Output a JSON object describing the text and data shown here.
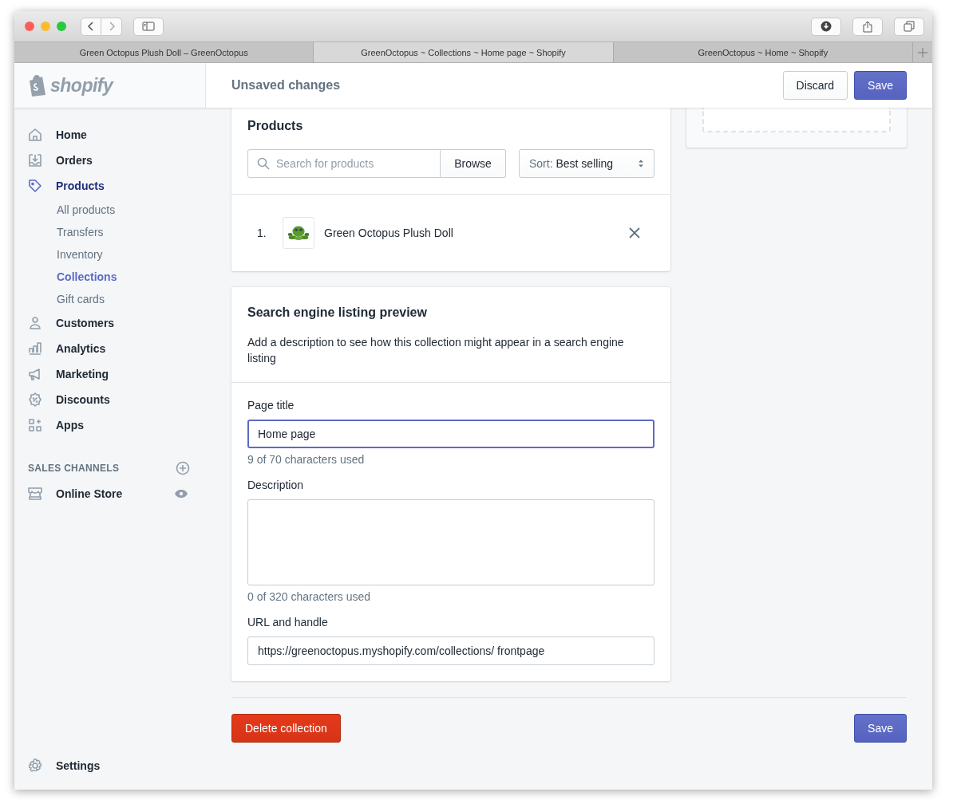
{
  "browser": {
    "tabs": [
      {
        "title": "Green Octopus Plush Doll – GreenOctopus",
        "selected": false
      },
      {
        "title": "GreenOctopus ~ Collections ~ Home page ~ Shopify",
        "selected": true
      },
      {
        "title": "GreenOctopus ~ Home ~ Shopify",
        "selected": false
      }
    ]
  },
  "header": {
    "logo": "shopify",
    "title": "Unsaved changes",
    "buttons": [
      "Discard",
      "Save"
    ]
  },
  "sidebar": {
    "items": [
      {
        "label": "Home",
        "selected": false
      },
      {
        "label": "Orders",
        "selected": false
      },
      {
        "label": "Products",
        "selected": true,
        "children": [
          {
            "label": "All products",
            "selected": false
          },
          {
            "label": "Transfers",
            "selected": false
          },
          {
            "label": "Inventory",
            "selected": false
          },
          {
            "label": "Collections",
            "selected": true
          },
          {
            "label": "Gift cards",
            "selected": false
          }
        ]
      },
      {
        "label": "Customers",
        "selected": false
      },
      {
        "label": "Analytics",
        "selected": false
      },
      {
        "label": "Marketing",
        "selected": false
      },
      {
        "label": "Discounts",
        "selected": false
      },
      {
        "label": "Apps",
        "selected": false
      }
    ],
    "sales_channels": {
      "heading": "SALES CHANNELS",
      "items": [
        {
          "label": "Online Store"
        }
      ]
    },
    "settings": "Settings"
  },
  "products": {
    "title": "Products",
    "search": {
      "placeholder": "Search for products"
    },
    "browse": "Browse",
    "sort": {
      "label": "Sort:",
      "value": "Best selling"
    },
    "items": [
      {
        "number": "1.",
        "name": "Green Octopus Plush Doll"
      }
    ]
  },
  "seo": {
    "title": "Search engine listing preview",
    "description": "Add a description to see how this collection might appear in a search engine listing",
    "fields": [
      {
        "label": "Page title",
        "kind": "input",
        "value": "Home page",
        "focused": true,
        "hint": "9 of 70 characters used"
      },
      {
        "label": "Description",
        "kind": "textarea",
        "hint": "0 of 320 characters used"
      },
      {
        "label": "URL and handle",
        "kind": "input",
        "value": "https://greenoctopus.myshopify.com/collections/ frontpage",
        "focused": false
      }
    ]
  },
  "footer": {
    "delete": "Delete collection",
    "save": "Save"
  }
}
